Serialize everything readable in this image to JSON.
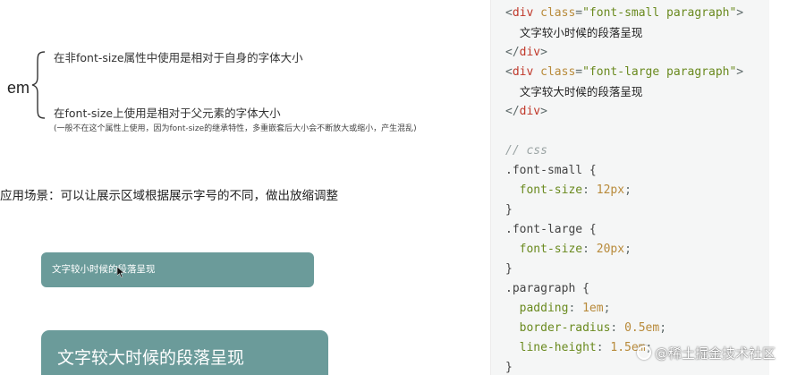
{
  "left": {
    "em_label": "em",
    "line1": "在非font-size属性中使用是相对于自身的字体大小",
    "line2": "在font-size上使用是相对于父元素的字体大小",
    "note": "(一般不在这个属性上使用，因为font-size的继承特性，多重嵌套后大小会不断放大或缩小，产生混乱)",
    "scenario": "应用场景：可以让展示区域根据展示字号的不同，做出放缩调整",
    "demo_small_text": "文字较小时候的段落呈现",
    "demo_large_text": "文字较大时候的段落呈现"
  },
  "code": {
    "lines": [
      {
        "parts": [
          [
            "punct",
            "<"
          ],
          [
            "tag",
            "div"
          ],
          [
            "attr",
            " class"
          ],
          [
            "punct",
            "="
          ],
          [
            "str",
            "\"font-small paragraph\""
          ],
          [
            "punct",
            ">"
          ]
        ]
      },
      {
        "parts": [
          [
            "text",
            "    文字较小时候的段落呈现"
          ]
        ]
      },
      {
        "parts": [
          [
            "punct",
            "</"
          ],
          [
            "tag",
            "div"
          ],
          [
            "punct",
            ">"
          ]
        ]
      },
      {
        "parts": [
          [
            "punct",
            "<"
          ],
          [
            "tag",
            "div"
          ],
          [
            "attr",
            " class"
          ],
          [
            "punct",
            "="
          ],
          [
            "str",
            "\"font-large paragraph\""
          ],
          [
            "punct",
            ">"
          ]
        ]
      },
      {
        "parts": [
          [
            "text",
            "    文字较大时候的段落呈现"
          ]
        ]
      },
      {
        "parts": [
          [
            "punct",
            "</"
          ],
          [
            "tag",
            "div"
          ],
          [
            "punct",
            ">"
          ]
        ]
      },
      {
        "parts": []
      },
      {
        "parts": [
          [
            "comment",
            "// css"
          ]
        ]
      },
      {
        "parts": [
          [
            "sel",
            ".font-small {"
          ]
        ]
      },
      {
        "parts": [
          [
            "prop",
            "  font-size"
          ],
          [
            "punct",
            ": "
          ],
          [
            "num",
            "12px"
          ],
          [
            "punct",
            ";"
          ]
        ]
      },
      {
        "parts": [
          [
            "sel",
            "}"
          ]
        ]
      },
      {
        "parts": [
          [
            "sel",
            ".font-large {"
          ]
        ]
      },
      {
        "parts": [
          [
            "prop",
            "  font-size"
          ],
          [
            "punct",
            ": "
          ],
          [
            "num",
            "20px"
          ],
          [
            "punct",
            ";"
          ]
        ]
      },
      {
        "parts": [
          [
            "sel",
            "}"
          ]
        ]
      },
      {
        "parts": [
          [
            "sel",
            ".paragraph {"
          ]
        ]
      },
      {
        "parts": [
          [
            "prop",
            "  padding"
          ],
          [
            "punct",
            ": "
          ],
          [
            "num",
            "1em"
          ],
          [
            "punct",
            ";"
          ]
        ]
      },
      {
        "parts": [
          [
            "prop",
            "  border-radius"
          ],
          [
            "punct",
            ": "
          ],
          [
            "num",
            "0.5em"
          ],
          [
            "punct",
            ";"
          ]
        ]
      },
      {
        "parts": [
          [
            "prop",
            "  line-height"
          ],
          [
            "punct",
            ": "
          ],
          [
            "num",
            "1.5em"
          ],
          [
            "punct",
            ";"
          ]
        ]
      },
      {
        "parts": [
          [
            "sel",
            "}"
          ]
        ]
      }
    ]
  },
  "watermark": "@稀土掘金技术社区",
  "colors": {
    "demo_bg": "#6b9b9a",
    "code_bg": "#f5f6f6"
  }
}
